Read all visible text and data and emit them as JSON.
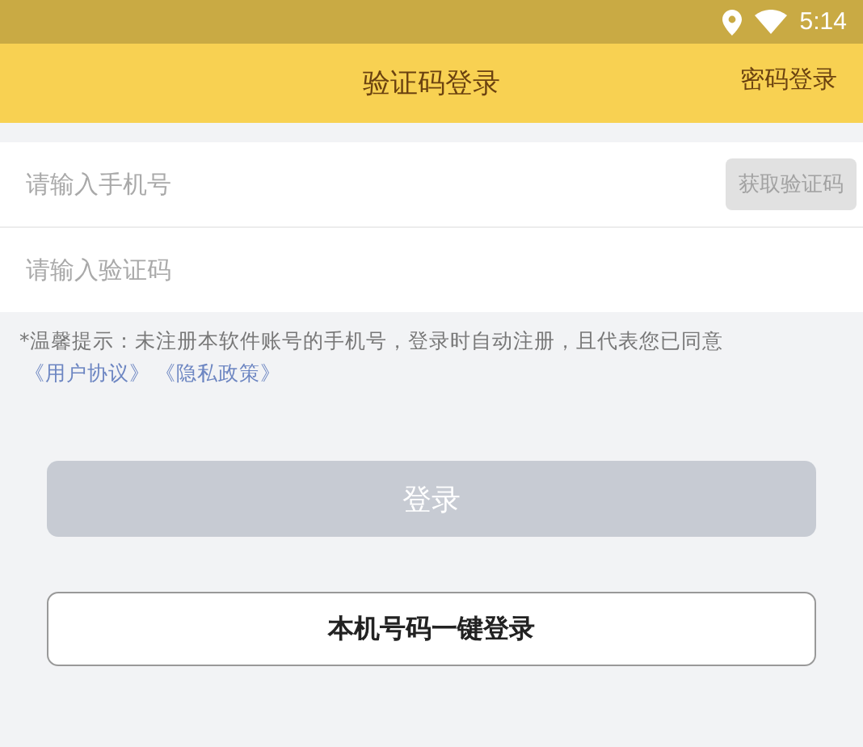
{
  "status_bar": {
    "time": "5:14"
  },
  "header": {
    "title": "验证码登录",
    "action": "密码登录"
  },
  "form": {
    "phone": {
      "placeholder": "请输入手机号"
    },
    "get_code_button": {
      "label": "获取验证码",
      "disabled": true
    },
    "code": {
      "placeholder": "请输入验证码"
    }
  },
  "notice": {
    "text": "*温馨提示：未注册本软件账号的手机号，登录时自动注册，且代表您已同意",
    "links": [
      "《用户协议》",
      "《隐私政策》"
    ]
  },
  "login_button": {
    "label": "登录",
    "disabled": true
  },
  "one_key_button": {
    "label": "本机号码一键登录"
  }
}
